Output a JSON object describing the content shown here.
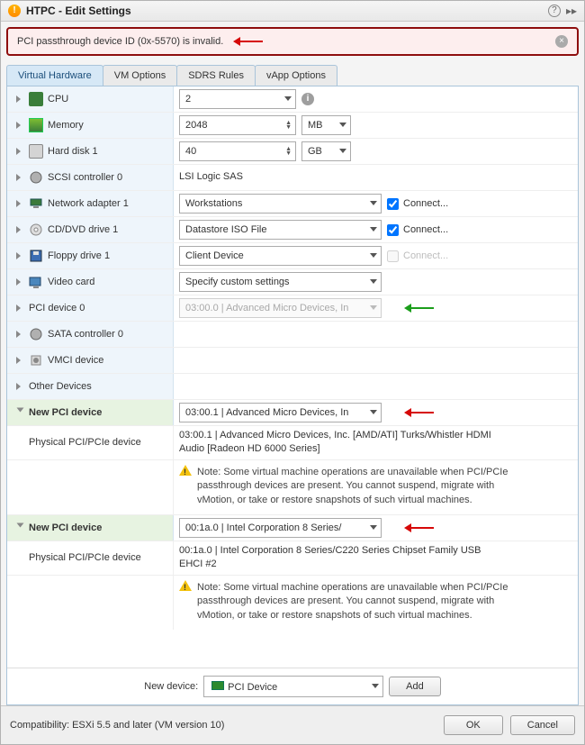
{
  "title": "HTPC - Edit Settings",
  "alert": {
    "text": "PCI passthrough device ID (0x-5570) is invalid."
  },
  "tabs": [
    "Virtual Hardware",
    "VM Options",
    "SDRS Rules",
    "vApp Options"
  ],
  "hw": {
    "cpu": {
      "label": "CPU",
      "value": "2"
    },
    "memory": {
      "label": "Memory",
      "value": "2048",
      "unit": "MB"
    },
    "hdd": {
      "label": "Hard disk 1",
      "value": "40",
      "unit": "GB"
    },
    "scsi": {
      "label": "SCSI controller 0",
      "value": "LSI Logic SAS"
    },
    "net": {
      "label": "Network adapter 1",
      "value": "Workstations",
      "connect": "Connect..."
    },
    "cd": {
      "label": "CD/DVD drive 1",
      "value": "Datastore ISO File",
      "connect": "Connect..."
    },
    "floppy": {
      "label": "Floppy drive 1",
      "value": "Client Device",
      "connect": "Connect..."
    },
    "video": {
      "label": "Video card",
      "value": "Specify custom settings"
    },
    "pci0": {
      "label": "PCI device 0",
      "value": "03:00.0 | Advanced Micro Devices, In"
    },
    "sata": {
      "label": "SATA controller 0"
    },
    "vmci": {
      "label": "VMCI device"
    },
    "other": {
      "label": "Other Devices"
    }
  },
  "newpci1": {
    "label": "New PCI device",
    "value": "03:00.1 | Advanced Micro Devices, In",
    "phys_label": "Physical PCI/PCIe device",
    "phys_text": "03:00.1 | Advanced Micro Devices, Inc. [AMD/ATI] Turks/Whistler HDMI Audio [Radeon HD 6000 Series]",
    "note": "Note: Some virtual machine operations are unavailable when PCI/PCIe passthrough devices are present. You cannot suspend, migrate with vMotion, or take or restore snapshots of such virtual machines."
  },
  "newpci2": {
    "label": "New PCI device",
    "value": "00:1a.0 | Intel Corporation 8 Series/",
    "phys_label": "Physical PCI/PCIe device",
    "phys_text": "00:1a.0 | Intel Corporation 8 Series/C220 Series Chipset Family USB EHCI #2",
    "note": "Note: Some virtual machine operations are unavailable when PCI/PCIe passthrough devices are present. You cannot suspend, migrate with vMotion, or take or restore snapshots of such virtual machines."
  },
  "new_device": {
    "label": "New device:",
    "value": "PCI Device",
    "add": "Add"
  },
  "compat": "Compatibility: ESXi 5.5 and later (VM version 10)",
  "buttons": {
    "ok": "OK",
    "cancel": "Cancel"
  }
}
